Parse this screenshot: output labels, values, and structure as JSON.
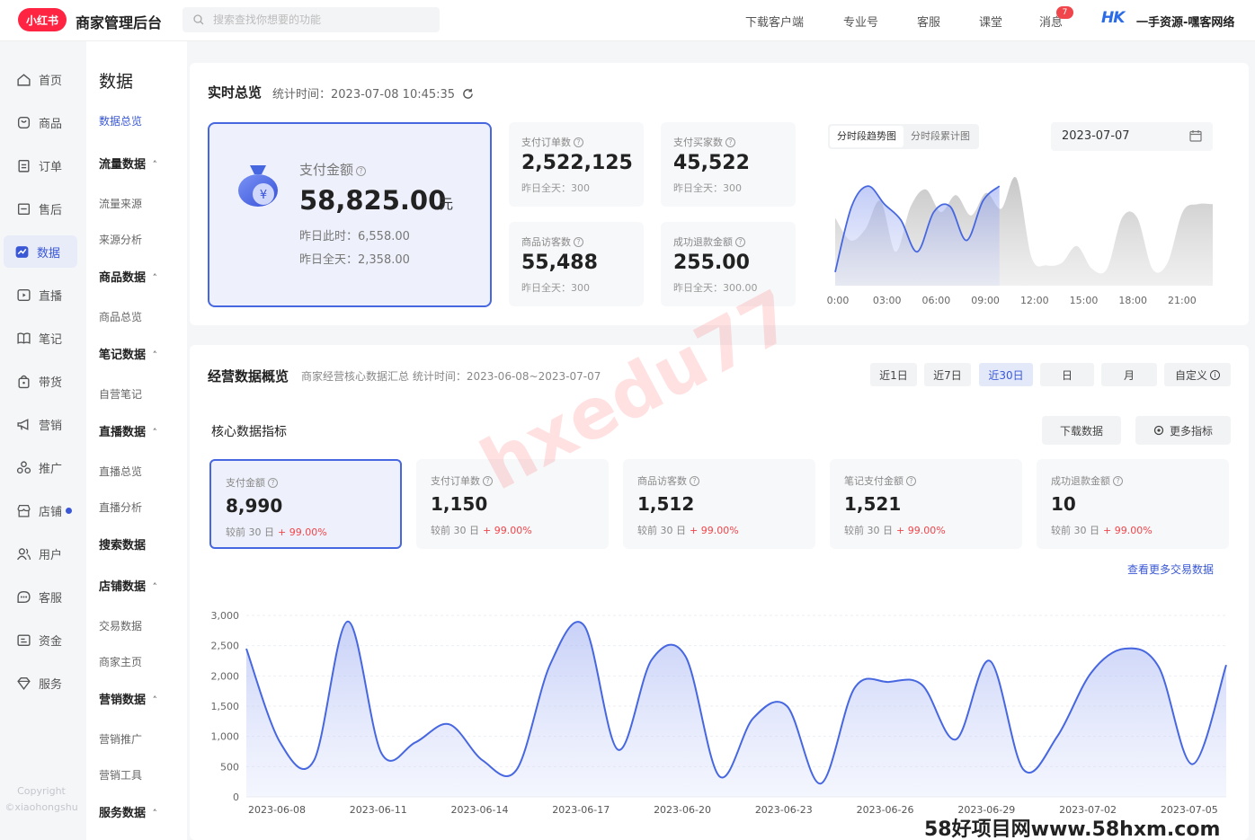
{
  "app": {
    "logo_text": "小红书",
    "title": "商家管理后台",
    "search_placeholder": "搜索查找你想要的功能",
    "top_links": [
      "下载客户端",
      "专业号",
      "客服",
      "课堂",
      "消息"
    ],
    "message_badge": "7",
    "account_logo": "HK",
    "shop_name": "一手资源-嘿客网络"
  },
  "nav": {
    "items": [
      {
        "label": "首页",
        "icon": "home-icon"
      },
      {
        "label": "商品",
        "icon": "product-icon"
      },
      {
        "label": "订单",
        "icon": "order-icon"
      },
      {
        "label": "售后",
        "icon": "after-sale-icon"
      },
      {
        "label": "数据",
        "icon": "data-icon",
        "active": true
      },
      {
        "label": "直播",
        "icon": "live-icon"
      },
      {
        "label": "笔记",
        "icon": "note-icon"
      },
      {
        "label": "带货",
        "icon": "bag-icon"
      },
      {
        "label": "营销",
        "icon": "megaphone-icon"
      },
      {
        "label": "推广",
        "icon": "promotion-icon"
      },
      {
        "label": "店铺",
        "icon": "store-icon",
        "dot": true
      },
      {
        "label": "用户",
        "icon": "users-icon"
      },
      {
        "label": "客服",
        "icon": "chat-icon"
      },
      {
        "label": "资金",
        "icon": "wallet-icon"
      },
      {
        "label": "服务",
        "icon": "diamond-icon"
      }
    ],
    "copyright_line1": "Copyright",
    "copyright_line2": "©xiaohongshu"
  },
  "subnav": {
    "title": "数据",
    "entries": [
      {
        "type": "item",
        "label": "数据总览",
        "active": true
      },
      {
        "type": "group",
        "label": "流量数据"
      },
      {
        "type": "item",
        "label": "流量来源"
      },
      {
        "type": "item",
        "label": "来源分析"
      },
      {
        "type": "group",
        "label": "商品数据"
      },
      {
        "type": "item",
        "label": "商品总览"
      },
      {
        "type": "group",
        "label": "笔记数据"
      },
      {
        "type": "item",
        "label": "自营笔记"
      },
      {
        "type": "group",
        "label": "直播数据"
      },
      {
        "type": "item",
        "label": "直播总览"
      },
      {
        "type": "item",
        "label": "直播分析"
      },
      {
        "type": "group",
        "label": "搜索数据",
        "no_arrow": true
      },
      {
        "type": "group",
        "label": "店铺数据"
      },
      {
        "type": "item",
        "label": "交易数据"
      },
      {
        "type": "item",
        "label": "商家主页"
      },
      {
        "type": "group",
        "label": "营销数据"
      },
      {
        "type": "item",
        "label": "营销推广"
      },
      {
        "type": "item",
        "label": "营销工具"
      },
      {
        "type": "group",
        "label": "服务数据"
      }
    ]
  },
  "realtime": {
    "title": "实时总览",
    "time_label": "统计时间：2023-07-08 10:45:35",
    "payment": {
      "label": "支付金额",
      "value": "58,825.00",
      "unit": "元",
      "yesterday_now": "昨日此时：6,558.00",
      "yesterday_all": "昨日全天：2,358.00"
    },
    "stats": [
      {
        "label": "支付订单数",
        "value": "2,522,125",
        "sub": "昨日全天：300"
      },
      {
        "label": "支付买家数",
        "value": "45,522",
        "sub": "昨日全天：300"
      },
      {
        "label": "商品访客数",
        "value": "55,488",
        "sub": "昨日全天：300"
      },
      {
        "label": "成功退款金额",
        "value": "255.00",
        "sub": "昨日全天：300.00"
      }
    ],
    "chart_tabs": [
      "分时段趋势图",
      "分时段累计图"
    ],
    "active_tab": 0,
    "date": "2023-07-07"
  },
  "overview": {
    "title": "经营数据概览",
    "desc": "商家经营核心数据汇总  统计时间：2023-06-08~2023-07-07",
    "ranges": [
      "近1日",
      "近7日",
      "近30日",
      "日",
      "月",
      "自定义"
    ],
    "active_range": 2,
    "core_title": "核心数据指标",
    "download_label": "下载数据",
    "more_metrics_label": "更多指标",
    "metrics": [
      {
        "label": "支付金额",
        "value": "8,990",
        "compare": "较前 30 日",
        "change": "+ 99.00%",
        "active": true
      },
      {
        "label": "支付订单数",
        "value": "1,150",
        "compare": "较前 30 日",
        "change": "+ 99.00%"
      },
      {
        "label": "商品访客数",
        "value": "1,512",
        "compare": "较前 30 日",
        "change": "+ 99.00%"
      },
      {
        "label": "笔记支付金额",
        "value": "1,521",
        "compare": "较前 30 日",
        "change": "+ 99.00%"
      },
      {
        "label": "成功退款金额",
        "value": "10",
        "compare": "较前 30 日",
        "change": "+ 99.00%"
      }
    ],
    "more_link": "查看更多交易数据"
  },
  "chart_data": [
    {
      "type": "area",
      "x_ticks": [
        "0:00",
        "03:00",
        "06:00",
        "09:00",
        "12:00",
        "15:00",
        "18:00",
        "21:00"
      ],
      "series": [
        {
          "values": [
            12,
            70,
            88,
            72,
            58,
            30,
            65,
            70,
            40,
            75,
            88
          ],
          "color": "#4767e0"
        },
        {
          "values": [
            60,
            40,
            50,
            75,
            30,
            70,
            85,
            65,
            80,
            62,
            82,
            68,
            95,
            25,
            18,
            20,
            35,
            15,
            15,
            60,
            60,
            15,
            20,
            65,
            72,
            72
          ],
          "color": "#cfcfcf"
        }
      ],
      "ylim": [
        0,
        100
      ]
    },
    {
      "type": "area",
      "x": [
        "2023-06-08",
        "2023-06-09",
        "2023-06-10",
        "2023-06-11",
        "2023-06-12",
        "2023-06-13",
        "2023-06-14",
        "2023-06-15",
        "2023-06-16",
        "2023-06-17",
        "2023-06-18",
        "2023-06-19",
        "2023-06-20",
        "2023-06-21",
        "2023-06-22",
        "2023-06-23",
        "2023-06-24",
        "2023-06-25",
        "2023-06-26",
        "2023-06-27",
        "2023-06-28",
        "2023-06-29",
        "2023-06-30",
        "2023-07-01",
        "2023-07-02",
        "2023-07-03",
        "2023-07-04",
        "2023-07-05",
        "2023-07-06",
        "2023-07-07"
      ],
      "x_ticks": [
        "2023-06-08",
        "2023-06-11",
        "2023-06-14",
        "2023-06-17",
        "2023-06-20",
        "2023-06-23",
        "2023-06-26",
        "2023-06-29",
        "2023-07-02",
        "2023-07-05"
      ],
      "series": [
        {
          "values": [
            2450,
            900,
            600,
            2900,
            720,
            900,
            1200,
            600,
            450,
            2200,
            2830,
            780,
            2270,
            2320,
            340,
            1300,
            1500,
            220,
            1800,
            1900,
            1850,
            950,
            2250,
            450,
            1000,
            2050,
            2450,
            2150,
            540,
            2180
          ],
          "color": "#4767e0"
        }
      ],
      "y_ticks": [
        "0",
        "500",
        "1,000",
        "1,500",
        "2,000",
        "2,500",
        "3,000"
      ],
      "ylim": [
        0,
        3000
      ]
    }
  ],
  "footer_mark": "58好项目网www.58hxm.com",
  "watermark": "hxedu77"
}
